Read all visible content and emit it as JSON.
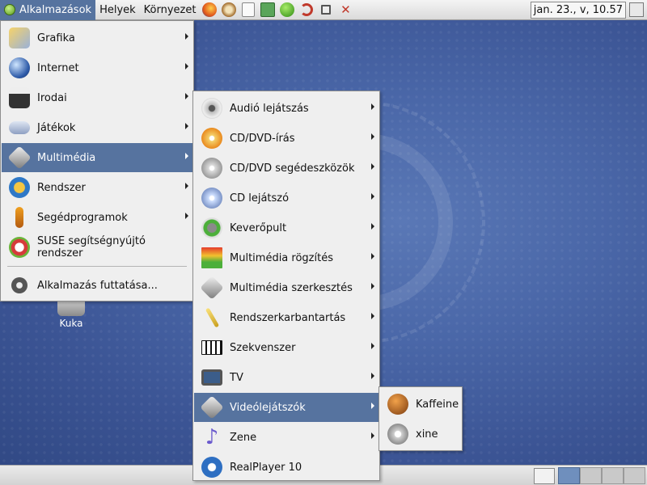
{
  "top_panel": {
    "applications": "Alkalmazások",
    "places": "Helyek",
    "environment": "Környezet",
    "clock": "jan. 23., v, 10.57"
  },
  "desktop": {
    "trash_label": "Kuka"
  },
  "applications_menu": {
    "items": [
      {
        "label": "Grafika",
        "icon": "graphics-icon",
        "submenu": true
      },
      {
        "label": "Internet",
        "icon": "internet-globe-icon",
        "submenu": true
      },
      {
        "label": "Irodai",
        "icon": "typewriter-icon",
        "submenu": true
      },
      {
        "label": "Játékok",
        "icon": "gamepad-icon",
        "submenu": true
      },
      {
        "label": "Multimédia",
        "icon": "multimedia-icon",
        "submenu": true,
        "selected": true
      },
      {
        "label": "Rendszer",
        "icon": "system-gears-icon",
        "submenu": true
      },
      {
        "label": "Segédprogramok",
        "icon": "tools-icon",
        "submenu": true
      },
      {
        "label": "SUSE segítségnyújtó rendszer",
        "icon": "lifebuoy-help-icon",
        "submenu": false
      }
    ],
    "run_app": "Alkalmazás futtatása..."
  },
  "multimedia_menu": {
    "items": [
      {
        "label": "Audió lejátszás",
        "icon": "speaker-icon",
        "submenu": true
      },
      {
        "label": "CD/DVD-írás",
        "icon": "cd-burn-icon",
        "submenu": true
      },
      {
        "label": "CD/DVD segédeszközök",
        "icon": "cd-tools-icon",
        "submenu": true
      },
      {
        "label": "CD lejátszó",
        "icon": "cd-music-icon",
        "submenu": true
      },
      {
        "label": "Keverőpult",
        "icon": "mixer-icon",
        "submenu": true
      },
      {
        "label": "Multimédia rögzítés",
        "icon": "level-meter-icon",
        "submenu": true
      },
      {
        "label": "Multimédia szerkesztés",
        "icon": "multimedia-edit-icon",
        "submenu": true
      },
      {
        "label": "Rendszerkarbantartás",
        "icon": "magic-wand-icon",
        "submenu": true
      },
      {
        "label": "Szekvenszer",
        "icon": "piano-keys-icon",
        "submenu": true
      },
      {
        "label": "TV",
        "icon": "tv-icon",
        "submenu": true
      },
      {
        "label": "Videólejátszók",
        "icon": "video-player-icon",
        "submenu": true,
        "selected": true
      },
      {
        "label": "Zene",
        "icon": "music-note-icon",
        "submenu": true
      },
      {
        "label": "RealPlayer 10",
        "icon": "realplayer-icon",
        "submenu": false
      }
    ]
  },
  "video_menu": {
    "items": [
      {
        "label": "Kaffeine",
        "icon": "kaffeine-icon"
      },
      {
        "label": "xine",
        "icon": "xine-icon"
      }
    ]
  },
  "colors": {
    "selection": "#56739f",
    "menu_bg": "#efefef",
    "desktop": "#4a67a8"
  }
}
